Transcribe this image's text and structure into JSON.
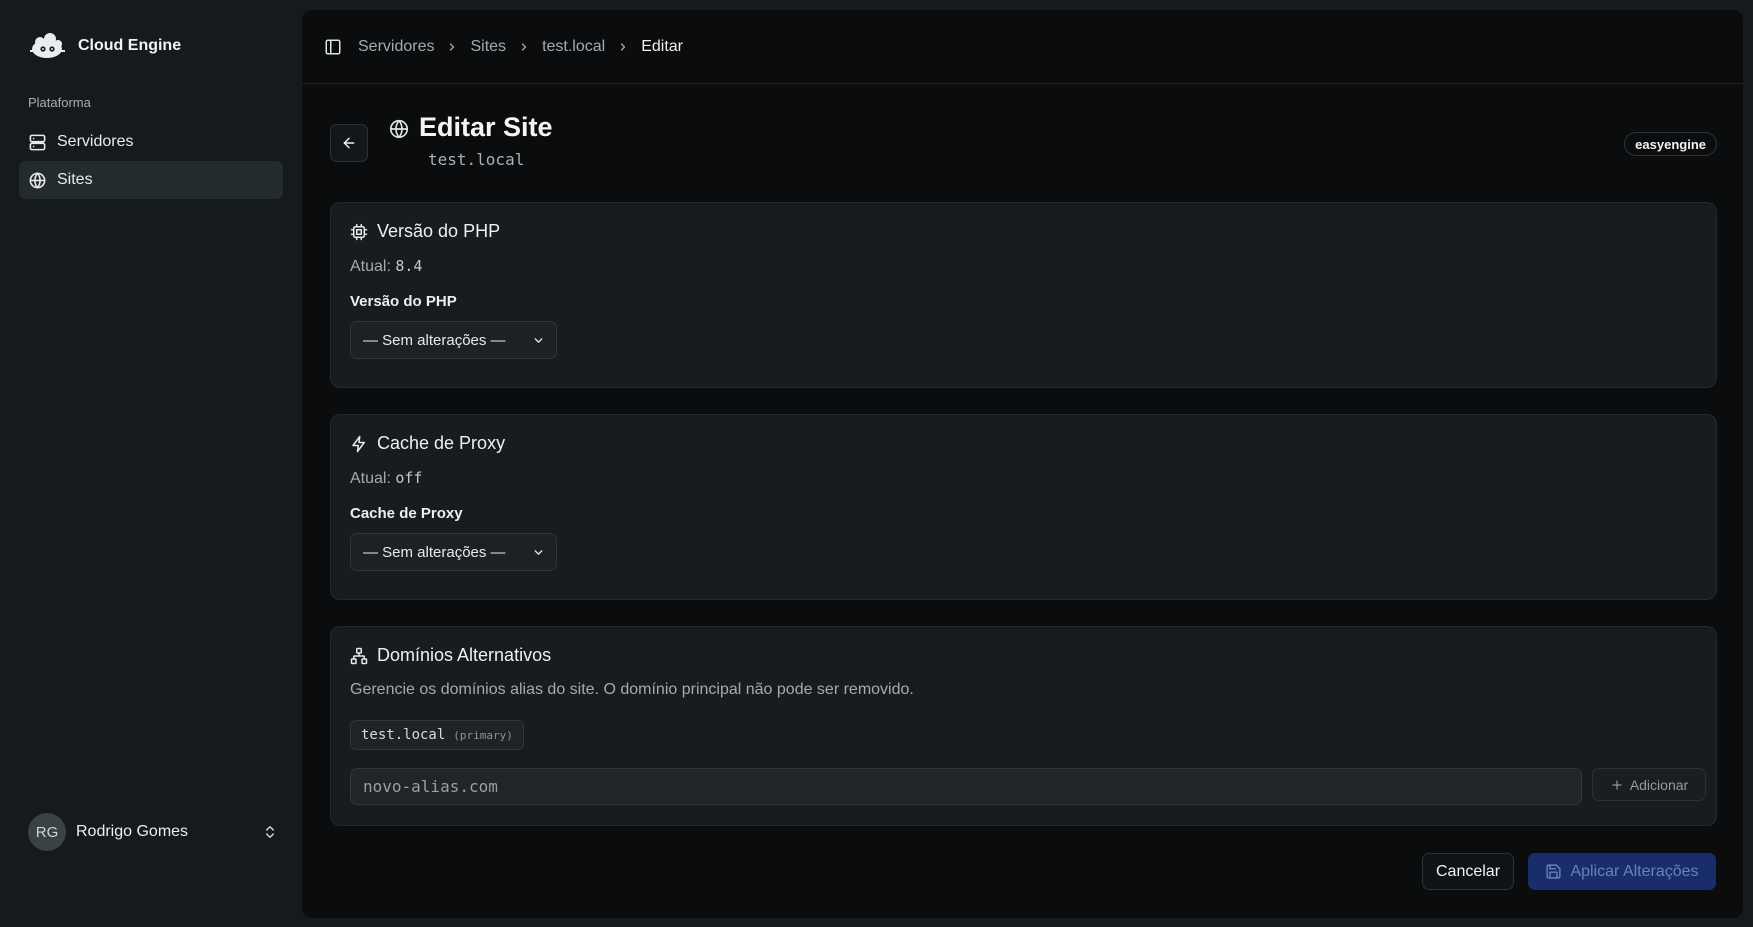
{
  "app": {
    "name": "Cloud Engine"
  },
  "sidebar": {
    "section_label": "Plataforma",
    "items": [
      {
        "label": "Servidores",
        "icon": "server-icon",
        "active": false
      },
      {
        "label": "Sites",
        "icon": "globe-icon",
        "active": true
      }
    ],
    "user": {
      "initials": "RG",
      "name": "Rodrigo Gomes"
    }
  },
  "breadcrumb": [
    "Servidores",
    "Sites",
    "test.local",
    "Editar"
  ],
  "page": {
    "title": "Editar Site",
    "subtitle": "test.local",
    "badge": "easyengine"
  },
  "php_card": {
    "title": "Versão do PHP",
    "current_prefix": "Atual:",
    "current_value": "8.4",
    "field_label": "Versão do PHP",
    "select_value": "— Sem alterações —"
  },
  "cache_card": {
    "title": "Cache de Proxy",
    "current_prefix": "Atual:",
    "current_value": "off",
    "field_label": "Cache de Proxy",
    "select_value": "— Sem alterações —"
  },
  "domains_card": {
    "title": "Domínios Alternativos",
    "description": "Gerencie os domínios alias do site. O domínio principal não pode ser removido.",
    "primary_domain": "test.local",
    "primary_tag": "(primary)",
    "input_placeholder": "novo-alias.com",
    "add_label": "Adicionar"
  },
  "actions": {
    "cancel_label": "Cancelar",
    "apply_label": "Aplicar Alterações"
  },
  "colors": {
    "background": "#151a1c",
    "panel": "#0a0c0d",
    "card": "#161c1f",
    "primary_button": "#1a2d6b"
  }
}
